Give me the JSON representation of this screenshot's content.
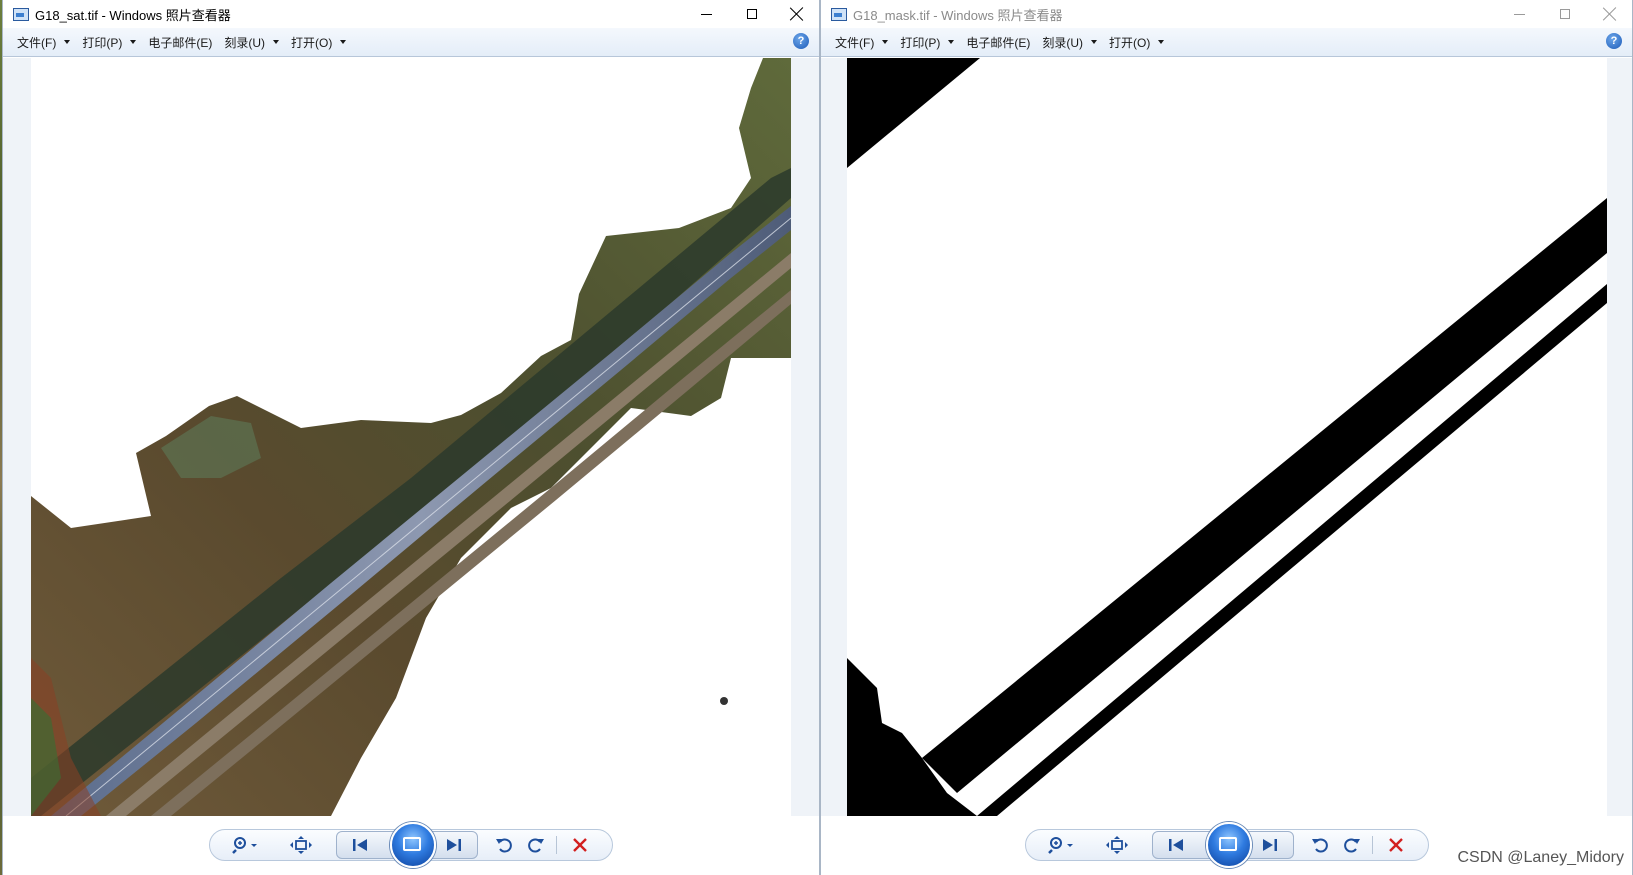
{
  "windows": [
    {
      "title": "G18_sat.tif - Windows 照片查看器",
      "menu": [
        {
          "label": "文件(F)",
          "has_arrow": true
        },
        {
          "label": "打印(P)",
          "has_arrow": true
        },
        {
          "label": "电子邮件(E)",
          "has_arrow": false
        },
        {
          "label": "刻录(U)",
          "has_arrow": true
        },
        {
          "label": "打开(O)",
          "has_arrow": true
        }
      ],
      "help_label": "?",
      "active": true,
      "toolbar": [
        "zoom-icon",
        "fit-window-icon",
        "previous-icon",
        "slideshow-icon",
        "next-icon",
        "rotate-left-icon",
        "rotate-right-icon",
        "delete-icon"
      ]
    },
    {
      "title": "G18_mask.tif - Windows 照片查看器",
      "menu": [
        {
          "label": "文件(F)",
          "has_arrow": true
        },
        {
          "label": "打印(P)",
          "has_arrow": true
        },
        {
          "label": "电子邮件(E)",
          "has_arrow": false
        },
        {
          "label": "刻录(U)",
          "has_arrow": true
        },
        {
          "label": "打开(O)",
          "has_arrow": true
        }
      ],
      "help_label": "?",
      "active": false,
      "toolbar": [
        "zoom-icon",
        "fit-window-icon",
        "previous-icon",
        "slideshow-icon",
        "next-icon",
        "rotate-left-icon",
        "rotate-right-icon",
        "delete-icon"
      ]
    }
  ],
  "watermark": "CSDN @Laney_Midory",
  "colors": {
    "menubar": "#e4edf8",
    "delete": "#d21f1f",
    "toolbar_icon": "#1e4f9c",
    "mask_road": "#000000"
  }
}
